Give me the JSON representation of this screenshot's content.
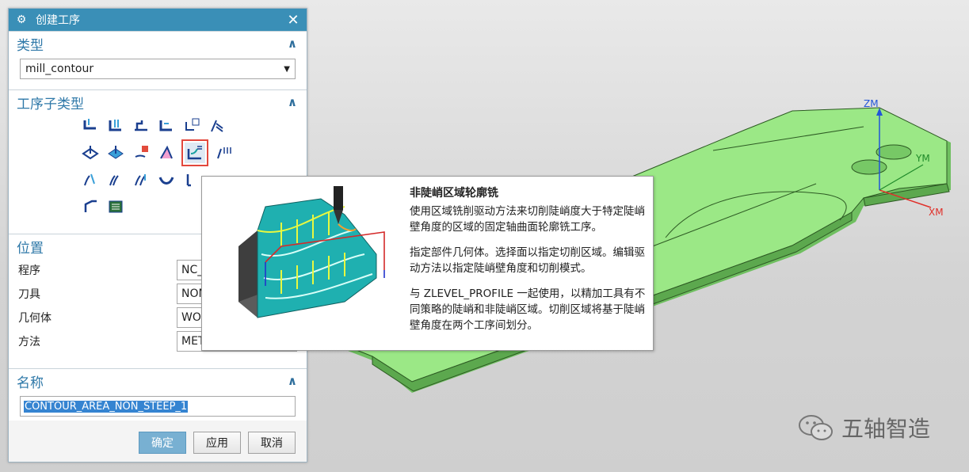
{
  "dialog": {
    "title": "创建工序",
    "close_glyph": "✕",
    "type_section": {
      "label": "类型",
      "selected": "mill_contour"
    },
    "subtype_section": {
      "label": "工序子类型"
    },
    "location_section": {
      "label": "位置",
      "fields": [
        {
          "label": "程序",
          "value": "NC_"
        },
        {
          "label": "刀具",
          "value": "NON"
        },
        {
          "label": "几何体",
          "value": "WO"
        },
        {
          "label": "方法",
          "value": "MET"
        }
      ]
    },
    "name_section": {
      "label": "名称",
      "value": "CONTOUR_AREA_NON_STEEP_1"
    },
    "buttons": {
      "ok": "确定",
      "apply": "应用",
      "cancel": "取消"
    }
  },
  "tooltip": {
    "title": "非陡峭区域轮廓铣",
    "paragraphs": [
      "使用区域铣削驱动方法来切削陡峭度大于特定陡峭壁角度的区域的固定轴曲面轮廓铣工序。",
      "指定部件几何体。选择面以指定切削区域。编辑驱动方法以指定陡峭壁角度和切削模式。",
      "与 ZLEVEL_PROFILE 一起使用，以精加工具有不同策略的陡峭和非陡峭区域。切削区域将基于陡峭壁角度在两个工序间划分。"
    ]
  },
  "viewport": {
    "axes": {
      "z": "ZM",
      "y": "YM",
      "x": "XM"
    },
    "part_color": "#8ee47a"
  },
  "watermark": {
    "text": "五轴智造",
    "icon": "wechat-icon"
  },
  "colors": {
    "accent": "#3a8fb7",
    "section_label": "#2e78a8",
    "selection_outline": "#e2483d"
  }
}
